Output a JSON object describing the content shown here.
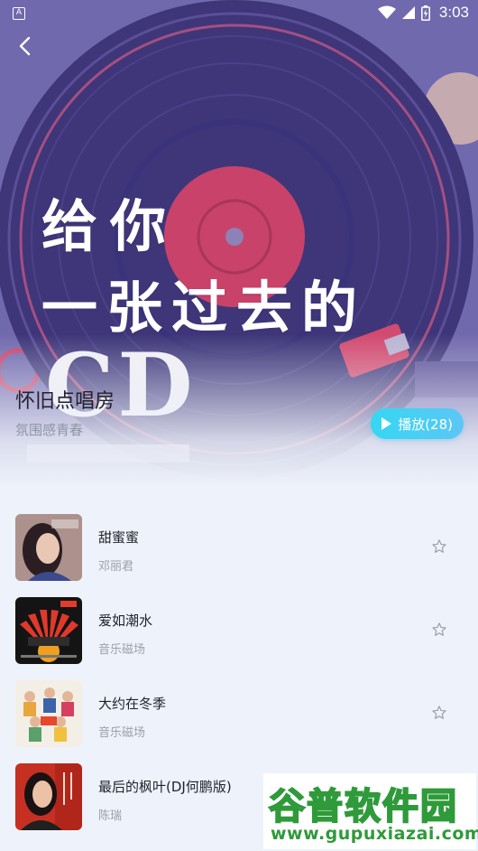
{
  "status_bar": {
    "notification_letter": "A",
    "time": "3:03"
  },
  "hero": {
    "headline_line1": "给你",
    "headline_line2": "一张过去的",
    "headline_line3": "CD"
  },
  "playlist": {
    "title": "怀旧点唱房",
    "subtitle": "氛围感青春",
    "play_label": "播放(28)"
  },
  "songs": [
    {
      "title": "甜蜜蜜",
      "artist": "邓丽君",
      "cover_icon": "cover-portrait"
    },
    {
      "title": "爱如潮水",
      "artist": "音乐磁场",
      "cover_icon": "cover-sunburst"
    },
    {
      "title": "大约在冬季",
      "artist": "音乐磁场",
      "cover_icon": "cover-group"
    },
    {
      "title": "最后的枫叶(DJ何鹏版)",
      "artist": "陈瑞",
      "cover_icon": "cover-portrait-red"
    }
  ],
  "watermark": {
    "brand": "谷普软件园",
    "url": "www.gupuxiazai.com"
  },
  "colors": {
    "accent": "#35d7f2",
    "watermark_green": "#2f9a3a",
    "vinyl_red": "#c8426a"
  }
}
